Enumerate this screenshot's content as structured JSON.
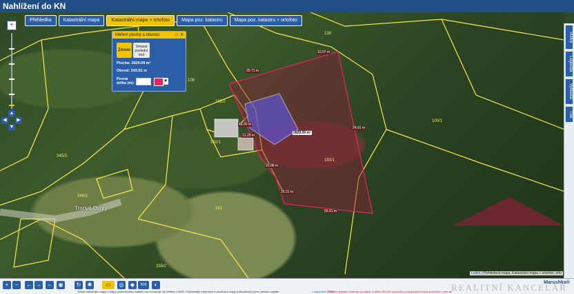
{
  "app": {
    "title": "Nahlížení do KN"
  },
  "tabs": [
    {
      "label": "Přehledka",
      "active": false
    },
    {
      "label": "Katastrální mapa",
      "active": false
    },
    {
      "label": "Katastrální mapa + ortofoto",
      "active": true
    },
    {
      "label": "Mapa poz. katastru",
      "active": false
    },
    {
      "label": "Mapa poz. katastru + ortofoto",
      "active": false
    }
  ],
  "side_tabs": [
    "Vrstvy",
    "Legenda",
    "Vyhledat",
    "Tisk"
  ],
  "measure_panel": {
    "title": "Měření plochy a obvodu",
    "new_button": "Znovu",
    "delete_point_button": "Smazat poslední bod",
    "area_text": "Plocha: 2829.09 m²",
    "perimeter_text": "Obvod: 243.91 m",
    "fixed_length_label": "Pevná délka (m):",
    "fixed_length_value": "",
    "color": "#e8245d"
  },
  "map": {
    "area_label": "2829.09 m²",
    "dimensions": [
      "10.07 m",
      "30.71 m",
      "55.61 m",
      "24.91 m",
      "23.88 m",
      "29.31 m",
      "48.90 m",
      "21.28 m"
    ],
    "parcels": [
      "138",
      "100/1",
      "193/1",
      "108",
      "182/2",
      "182/1",
      "345/3",
      "346/2",
      "191",
      "335/2"
    ],
    "place": "Trnové Dvory"
  },
  "footer": {
    "note": "Obsah katastrální mapy a mapy pozemkového katastru se zobrazuje od měřítka 1:5000. Podrobnější informace k používání mapy a aktuálnosti jejího obsahu najdete",
    "link": "v nápovědě (PDF)",
    "warning": "Veškeré grafické hodnoty souřadnic a délek NELZE využívat pro vytyčování hranic pozemků v terénu!",
    "brand": "Marushka®",
    "watermark": "REALITNÍ KANCELÁŘ"
  },
  "credits": {
    "link": "Ludiol",
    "text": "Přehledová mapa, Katastrální mapa + ortofoto, orto"
  },
  "colors": {
    "header": "#1f4d86",
    "accent": "#f2c400",
    "tab_blue": "#2a5ea8",
    "measure": "#e8245d"
  }
}
